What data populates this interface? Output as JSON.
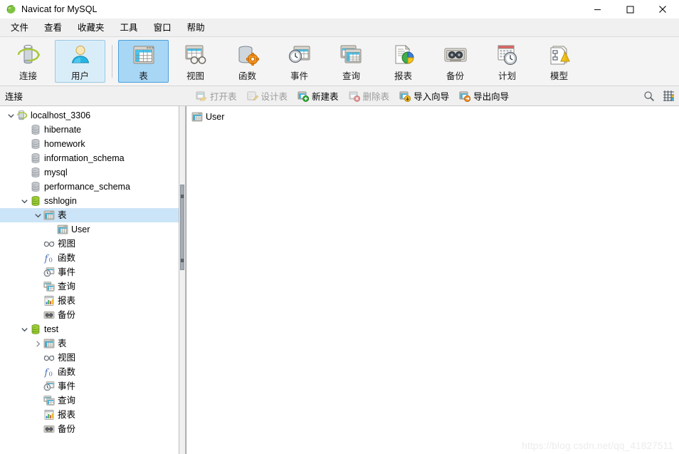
{
  "window": {
    "title": "Navicat for MySQL",
    "app_icon": "navicat-logo-icon",
    "controls": {
      "minimize": "–",
      "maximize": "☐",
      "close": "✕"
    }
  },
  "menubar": {
    "items": [
      {
        "label": "文件",
        "name": "menu-file"
      },
      {
        "label": "查看",
        "name": "menu-view"
      },
      {
        "label": "收藏夹",
        "name": "menu-favorites"
      },
      {
        "label": "工具",
        "name": "menu-tools"
      },
      {
        "label": "窗口",
        "name": "menu-window"
      },
      {
        "label": "帮助",
        "name": "menu-help"
      }
    ]
  },
  "toolbar": {
    "buttons": [
      {
        "label": "连接",
        "icon": "connection-icon",
        "state": "normal"
      },
      {
        "label": "用户",
        "icon": "user-icon",
        "state": "hover"
      },
      {
        "label": "表",
        "icon": "table-icon",
        "state": "active"
      },
      {
        "label": "视图",
        "icon": "view-icon",
        "state": "normal"
      },
      {
        "label": "函数",
        "icon": "function-icon",
        "state": "normal"
      },
      {
        "label": "事件",
        "icon": "event-icon",
        "state": "normal"
      },
      {
        "label": "查询",
        "icon": "query-icon",
        "state": "normal"
      },
      {
        "label": "报表",
        "icon": "report-icon",
        "state": "normal"
      },
      {
        "label": "备份",
        "icon": "backup-icon",
        "state": "normal"
      },
      {
        "label": "计划",
        "icon": "schedule-icon",
        "state": "normal"
      },
      {
        "label": "模型",
        "icon": "model-icon",
        "state": "normal"
      }
    ]
  },
  "subbar": {
    "connections_label": "连接",
    "actions": [
      {
        "label": "打开表",
        "icon": "open-table-icon",
        "disabled": true
      },
      {
        "label": "设计表",
        "icon": "design-table-icon",
        "disabled": true
      },
      {
        "label": "新建表",
        "icon": "new-table-icon",
        "disabled": false
      },
      {
        "label": "删除表",
        "icon": "delete-table-icon",
        "disabled": true
      },
      {
        "label": "导入向导",
        "icon": "import-wizard-icon",
        "disabled": false
      },
      {
        "label": "导出向导",
        "icon": "export-wizard-icon",
        "disabled": false
      }
    ],
    "right_icons": [
      {
        "name": "search-icon"
      },
      {
        "name": "grid-view-icon"
      }
    ]
  },
  "sidebar": {
    "tree": [
      {
        "label": "localhost_3306",
        "icon": "server-connection-icon",
        "indent": 0,
        "expander": "expanded",
        "selected": false
      },
      {
        "label": "hibernate",
        "icon": "database-gray-icon",
        "indent": 1,
        "expander": "none",
        "selected": false
      },
      {
        "label": "homework",
        "icon": "database-gray-icon",
        "indent": 1,
        "expander": "none",
        "selected": false
      },
      {
        "label": "information_schema",
        "icon": "database-gray-icon",
        "indent": 1,
        "expander": "none",
        "selected": false
      },
      {
        "label": "mysql",
        "icon": "database-gray-icon",
        "indent": 1,
        "expander": "none",
        "selected": false
      },
      {
        "label": "performance_schema",
        "icon": "database-gray-icon",
        "indent": 1,
        "expander": "none",
        "selected": false
      },
      {
        "label": "sshlogin",
        "icon": "database-open-icon",
        "indent": 1,
        "expander": "expanded",
        "selected": false
      },
      {
        "label": "表",
        "icon": "table-folder-icon",
        "indent": 2,
        "expander": "expanded",
        "selected": true
      },
      {
        "label": "User",
        "icon": "table-item-icon",
        "indent": 3,
        "expander": "none",
        "selected": false
      },
      {
        "label": "视图",
        "icon": "view-folder-icon",
        "indent": 2,
        "expander": "none",
        "selected": false
      },
      {
        "label": "函数",
        "icon": "function-folder-icon",
        "indent": 2,
        "expander": "none",
        "selected": false
      },
      {
        "label": "事件",
        "icon": "event-folder-icon",
        "indent": 2,
        "expander": "none",
        "selected": false
      },
      {
        "label": "查询",
        "icon": "query-folder-icon",
        "indent": 2,
        "expander": "none",
        "selected": false
      },
      {
        "label": "报表",
        "icon": "report-folder-icon",
        "indent": 2,
        "expander": "none",
        "selected": false
      },
      {
        "label": "备份",
        "icon": "backup-folder-icon",
        "indent": 2,
        "expander": "none",
        "selected": false
      },
      {
        "label": "test",
        "icon": "database-open-icon",
        "indent": 1,
        "expander": "expanded",
        "selected": false
      },
      {
        "label": "表",
        "icon": "table-folder-icon",
        "indent": 2,
        "expander": "collapsed",
        "selected": false
      },
      {
        "label": "视图",
        "icon": "view-folder-icon",
        "indent": 2,
        "expander": "none",
        "selected": false
      },
      {
        "label": "函数",
        "icon": "function-folder-icon",
        "indent": 2,
        "expander": "none",
        "selected": false
      },
      {
        "label": "事件",
        "icon": "event-folder-icon",
        "indent": 2,
        "expander": "none",
        "selected": false
      },
      {
        "label": "查询",
        "icon": "query-folder-icon",
        "indent": 2,
        "expander": "none",
        "selected": false
      },
      {
        "label": "报表",
        "icon": "report-folder-icon",
        "indent": 2,
        "expander": "none",
        "selected": false
      },
      {
        "label": "备份",
        "icon": "backup-folder-icon",
        "indent": 2,
        "expander": "none",
        "selected": false
      }
    ]
  },
  "main": {
    "objects": [
      {
        "label": "User",
        "icon": "table-item-icon"
      }
    ],
    "watermark": "https://blog.csdn.net/qq_41827511"
  },
  "colors": {
    "toolbar_bg": "#f4f4f4",
    "menubar_bg": "#f0f0f0",
    "selection_blue": "#cce4f7",
    "toolbar_active": "#a8d6f5",
    "toolbar_hover": "#d9edf9",
    "accent_blue": "#4a9edc",
    "db_green": "#8dc63f",
    "watermark_gray": "#ececec"
  }
}
